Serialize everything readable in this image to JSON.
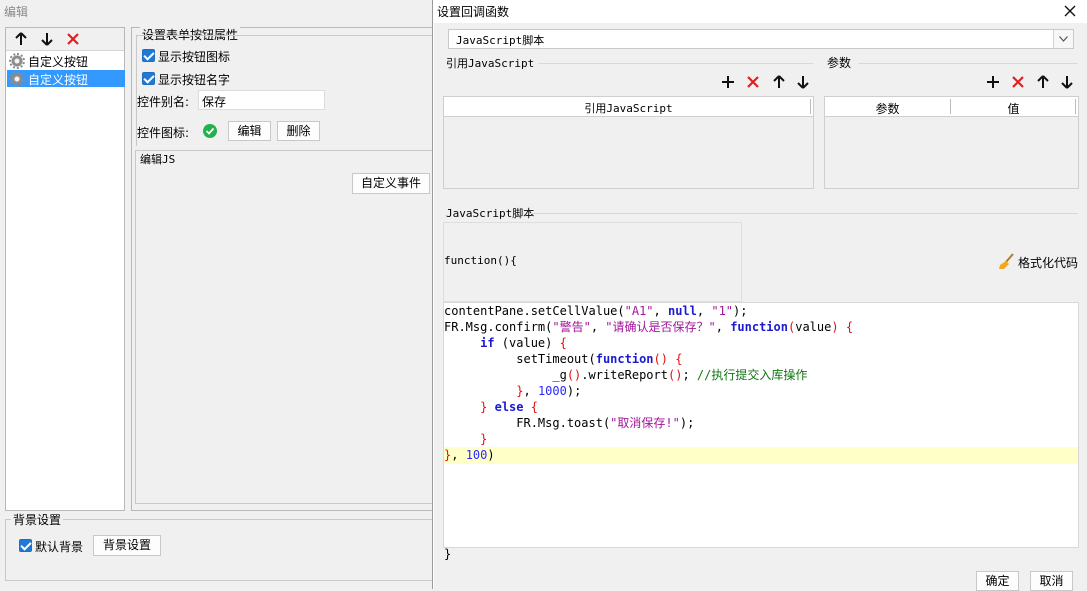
{
  "left_window": {
    "title": "编辑",
    "tree_items": [
      "自定义按钮",
      "自定义按钮"
    ],
    "props_title": "设置表单按钮属性",
    "show_icon": "显示按钮图标",
    "show_name": "显示按钮名字",
    "alias_label": "控件别名:",
    "alias_value": "保存",
    "icon_label": "控件图标:",
    "edit_btn": "编辑",
    "delete_btn": "删除",
    "edit_js": "编辑JS",
    "custom_event": "自定义事件",
    "bg_section": "背景设置",
    "default_bg": "默认背景",
    "bg_button": "背景设置"
  },
  "dialog": {
    "title": "设置回调函数",
    "type_select": "JavaScript脚本",
    "ref_js_section": "引用JavaScript",
    "ref_js_col": "引用JavaScript",
    "params_section": "参数",
    "params_col1": "参数",
    "params_col2": "值",
    "script_section": "JavaScript脚本",
    "function_header": "function(){",
    "format_code": "格式化代码",
    "closing_brace": "}",
    "ok": "确定",
    "cancel": "取消"
  },
  "code_lines": [
    "contentPane.setCellValue(\"A1\", null, \"1\");",
    "FR.Msg.confirm(\"警告\", \"请确认是否保存？\", function(value) {",
    "     if (value) {",
    "          setTimeout(function() {",
    "               _g().writeReport(); //执行提交入库操作",
    "          }, 1000);",
    "     } else {",
    "          FR.Msg.toast(\"取消保存!\");",
    "     }",
    "}, 100)"
  ],
  "colors": {
    "accent": "#1e7ad6",
    "delete_red": "#e02020",
    "highlight_line": "#ffffc8",
    "selection": "#3399ff",
    "ok_green": "#22b14c"
  }
}
